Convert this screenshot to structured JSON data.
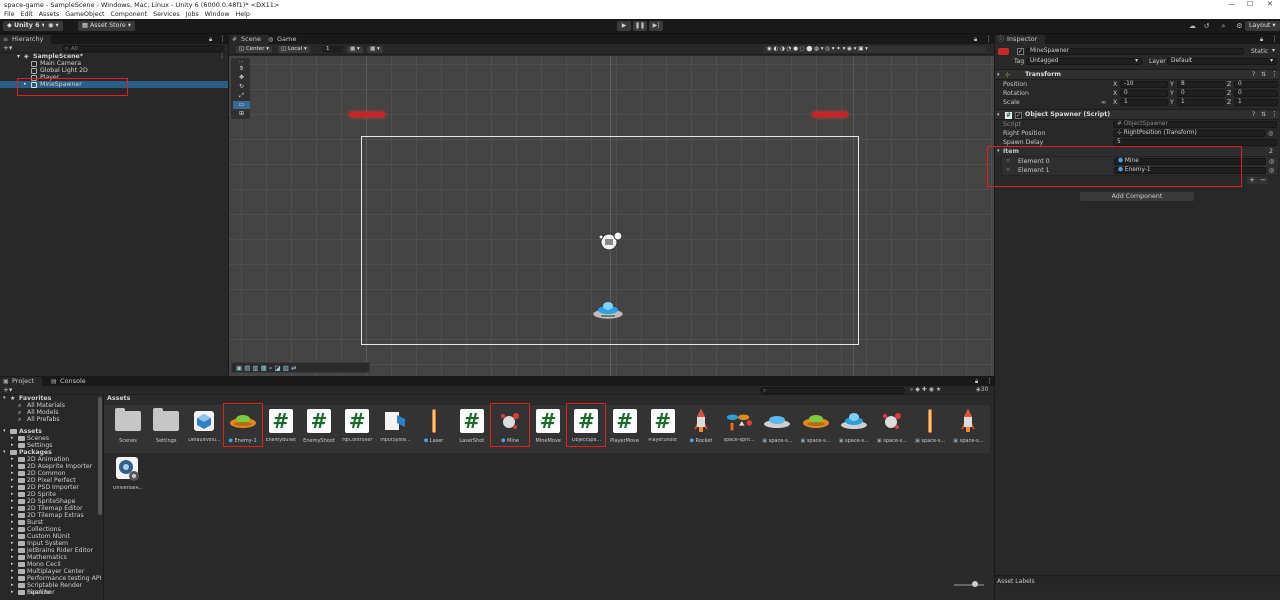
{
  "window": {
    "title": "space-game - SampleScene - Windows, Mac, Linux - Unity 6 (6000.0.48f1)* <DX11>",
    "controls": [
      "—",
      "☐",
      "✕"
    ]
  },
  "menu": [
    "File",
    "Edit",
    "Assets",
    "GameObject",
    "Component",
    "Services",
    "Jobs",
    "Window",
    "Help"
  ],
  "toolbar": {
    "account": "Unity 6",
    "asset_store": "Asset Store",
    "layout": "Layout",
    "search_icon": "search-icon",
    "gear_icon": "gear-icon"
  },
  "hierarchy": {
    "tab": "Hierarchy",
    "search_placeholder": "All",
    "items": [
      {
        "label": "SampleScene*",
        "indent": 0,
        "bold": true
      },
      {
        "label": "Main Camera",
        "indent": 1
      },
      {
        "label": "Global Light 2D",
        "indent": 1
      },
      {
        "label": "Player",
        "indent": 1
      },
      {
        "label": "MineSpawner",
        "indent": 1,
        "selected": true
      }
    ]
  },
  "scene": {
    "tabs": [
      "Scene",
      "Game"
    ],
    "pivot": "Center",
    "space": "Local",
    "snap": "1"
  },
  "inspector": {
    "tab": "Inspector",
    "object_name": "MineSpawner",
    "static_label": "Static",
    "tag_label": "Tag",
    "tag_value": "Untagged",
    "layer_label": "Layer",
    "layer_value": "Default",
    "transform": {
      "title": "Transform",
      "rows": [
        {
          "label": "Position",
          "x": "-10",
          "y": "8",
          "z": "0"
        },
        {
          "label": "Rotation",
          "x": "0",
          "y": "0",
          "z": "0"
        },
        {
          "label": "Scale",
          "x": "1",
          "y": "1",
          "z": "1"
        }
      ],
      "axis": [
        "X",
        "Y",
        "Z"
      ],
      "scale_link": "∞"
    },
    "spawner": {
      "title": "Object Spawner (Script)",
      "script_label": "Script",
      "script_value": "ObjectSpawner",
      "right_position_label": "Right Position",
      "right_position_value": "RightPosition (Transform)",
      "spawn_delay_label": "Spawn Delay",
      "spawn_delay_value": "5",
      "item_label": "Item",
      "item_count": "2",
      "elements": [
        {
          "label": "Element 0",
          "value": "Mine"
        },
        {
          "label": "Element 1",
          "value": "Enemy-1"
        }
      ],
      "add": "+",
      "remove": "−"
    },
    "add_component": "Add Component",
    "asset_labels": "Asset Labels"
  },
  "project": {
    "tabs": [
      "Project",
      "Console"
    ],
    "assets_header": "Assets",
    "count": "30",
    "favorites": {
      "label": "Favorites",
      "items": [
        "All Materials",
        "All Models",
        "All Prefabs"
      ]
    },
    "assets_tree": {
      "label": "Assets",
      "items": [
        "Scenes",
        "Settings"
      ]
    },
    "packages": {
      "label": "Packages",
      "items": [
        "2D Animation",
        "2D Aseprite Importer",
        "2D Common",
        "2D Pixel Perfect",
        "2D PSD Importer",
        "2D Sprite",
        "2D SpriteShape",
        "2D Tilemap Editor",
        "2D Tilemap Extras",
        "Burst",
        "Collections",
        "Custom NUnit",
        "Input System",
        "JetBrains Rider Editor",
        "Mathematics",
        "Mono Cecil",
        "Multiplayer Center",
        "Performance testing API",
        "Scriptable Render Pipeline",
        "Searcher"
      ]
    },
    "grid": [
      {
        "label": "Scenes",
        "kind": "folder"
      },
      {
        "label": "Settings",
        "kind": "folder"
      },
      {
        "label": "DefaultVolu...",
        "kind": "cube"
      },
      {
        "label": "Enemy-1",
        "kind": "ufo-orange",
        "prefab": true,
        "highlight": true
      },
      {
        "label": "EnemyBullet",
        "kind": "script"
      },
      {
        "label": "EnemyShoot",
        "kind": "script"
      },
      {
        "label": "HpController",
        "kind": "script"
      },
      {
        "label": "InputSyste...",
        "kind": "inputs"
      },
      {
        "label": "Laser",
        "kind": "laser",
        "prefab": true
      },
      {
        "label": "LaserShot",
        "kind": "script"
      },
      {
        "label": "Mine",
        "kind": "mine",
        "prefab": true,
        "highlight": true
      },
      {
        "label": "MineMove",
        "kind": "script"
      },
      {
        "label": "ObjectSpa...",
        "kind": "script",
        "highlight": true
      },
      {
        "label": "PlayerMove",
        "kind": "script"
      },
      {
        "label": "PlayerShoot",
        "kind": "script"
      },
      {
        "label": "Rocket",
        "kind": "rocket",
        "prefab": true
      },
      {
        "label": "space-sprit...",
        "kind": "sheet"
      },
      {
        "label": "space-s...",
        "kind": "ufo-blue",
        "sprite": true
      },
      {
        "label": "space-s...",
        "kind": "ufo-orange",
        "sprite": true
      },
      {
        "label": "space-s...",
        "kind": "ufo-blue2",
        "sprite": true
      },
      {
        "label": "space-s...",
        "kind": "mine",
        "sprite": true
      },
      {
        "label": "space-s...",
        "kind": "laser",
        "sprite": true
      },
      {
        "label": "space-s...",
        "kind": "rocket",
        "sprite": true
      },
      {
        "label": "UniversalR...",
        "kind": "urp"
      }
    ]
  },
  "colors": {
    "accent_selected": "#2c5d87",
    "highlight_red": "#e02020",
    "script_green": "#1a6a2a"
  }
}
